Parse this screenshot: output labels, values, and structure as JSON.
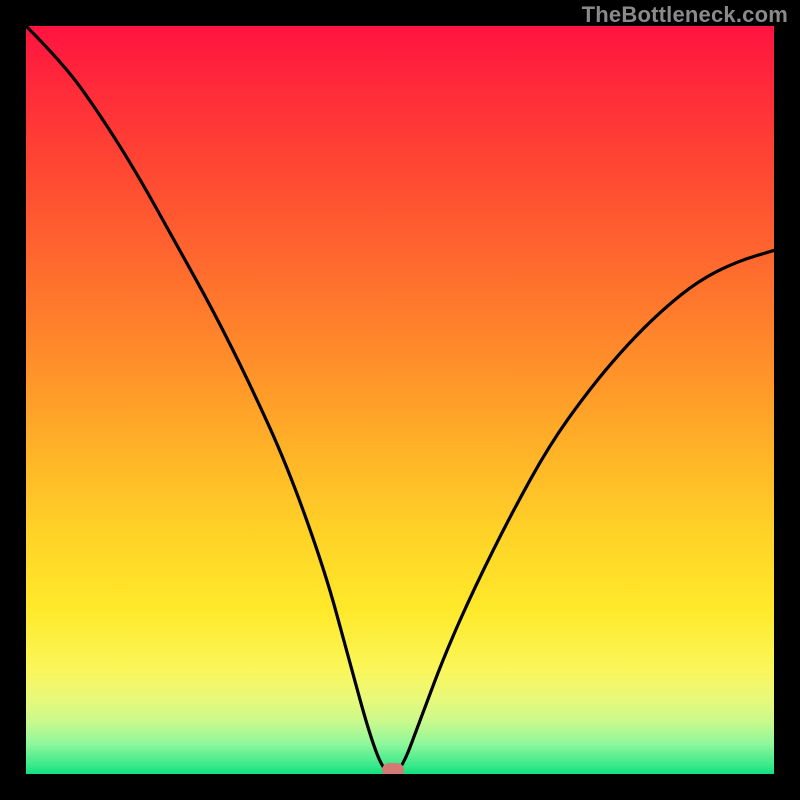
{
  "watermark": "TheBottleneck.com",
  "colors": {
    "frame": "#000000",
    "curve": "#000000",
    "marker": "#d47a74",
    "gradient_top": "#ff1340",
    "gradient_bottom": "#12df7f"
  },
  "chart_data": {
    "type": "line",
    "title": "",
    "xlabel": "",
    "ylabel": "",
    "xlim": [
      0,
      100
    ],
    "ylim": [
      0,
      100
    ],
    "grid": false,
    "description": "V-shaped bottleneck curve with minimum near x≈48; background color represents value (red=high bottleneck, green=low).",
    "series": [
      {
        "name": "bottleneck-curve",
        "x": [
          0,
          5,
          10,
          15,
          20,
          25,
          30,
          35,
          40,
          43,
          46,
          48,
          50,
          53,
          56,
          60,
          65,
          70,
          75,
          80,
          85,
          90,
          95,
          100
        ],
        "y": [
          100,
          95,
          88,
          80,
          71,
          62,
          52,
          41,
          27,
          16,
          5,
          0,
          0,
          8,
          16,
          25,
          35,
          44,
          51,
          57,
          62,
          66,
          68.5,
          70
        ]
      }
    ],
    "marker": {
      "x": 49,
      "y": 0.5
    }
  }
}
